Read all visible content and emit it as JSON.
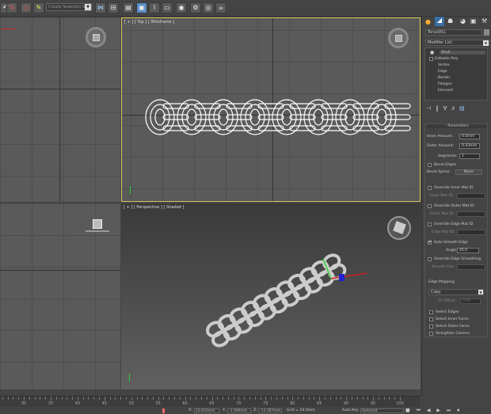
{
  "toolbar": {
    "selection_set": "Create Selection S",
    "icons": [
      "undo-icon",
      "percent-snap-icon",
      "spinner-snap-icon",
      "edit-named-selection-icon",
      "mirror-icon",
      "align-icon",
      "layer-manager-icon",
      "graphite-ribbon-icon",
      "curve-editor-icon",
      "schematic-view-icon",
      "material-editor-icon",
      "render-setup-icon",
      "render-frame-icon",
      "render-icon"
    ]
  },
  "viewports": {
    "top": {
      "label": "[ + ] [ Top ] [ Wireframe ]"
    },
    "perspective": {
      "label": "[ + ] [ Perspective ] [ Shaded ]"
    }
  },
  "command_panel": {
    "tabs": [
      "create-icon",
      "modify-icon",
      "hierarchy-icon",
      "motion-icon",
      "display-icon",
      "utilities-icon"
    ],
    "object_name": "Torus001",
    "modifier_list": "Modifier List",
    "stack": [
      {
        "label": "Shell",
        "level": 0
      },
      {
        "label": "Editable Poly",
        "level": 0
      },
      {
        "label": "Vertex",
        "level": 1
      },
      {
        "label": "Edge",
        "level": 1
      },
      {
        "label": "Border",
        "level": 1
      },
      {
        "label": "Polygon",
        "level": 1
      },
      {
        "label": "Element",
        "level": 1
      }
    ],
    "rollout_title": "Parameters",
    "inner_amount_label": "Inner Amount:",
    "inner_amount": "0.0mm",
    "outer_amount_label": "Outer Amount:",
    "outer_amount": "0.43mm",
    "segments_label": "Segments:",
    "segments": "1",
    "bevel_edges": "Bevel Edges",
    "bevel_spline_label": "Bevel Spline:",
    "bevel_spline": "None",
    "override_inner": "Override Inner Mat ID",
    "inner_mat_label": "Inner Mat ID:",
    "override_outer": "Override Outer Mat ID",
    "outer_mat_label": "Outer Mat ID:",
    "override_edge": "Override Edge Mat ID",
    "edge_mat_label": "Edge Mat ID:",
    "auto_smooth": "Auto Smooth Edge",
    "auto_smooth_checked": true,
    "angle_label": "Angle:",
    "angle": "45.0",
    "override_smooth": "Override Edge Smoothing",
    "smooth_grp_label": "Smooth Grp:",
    "edge_mapping_label": "Edge Mapping",
    "edge_mapping": "Copy",
    "tv_offset_label": "TV Offset:",
    "tv_offset": "0.05",
    "select_edges": "Select Edges",
    "select_inner": "Select Inner Faces",
    "select_outer": "Select Outer Faces",
    "straighten": "Straighten Corners"
  },
  "timeline": {
    "ticks": [
      30,
      35,
      40,
      45,
      50,
      55,
      60,
      65,
      70,
      75,
      80,
      85,
      90,
      95,
      100
    ]
  },
  "status": {
    "x": "23.816mm",
    "y": "-1.096mm",
    "z": "-13.187mm",
    "grid": "Grid = 10.0mm",
    "auto_key": "Auto Key",
    "selected": "Selected"
  },
  "colors": {
    "active_viewport": "#d8c25a",
    "active_button": "#5b8fc7",
    "x_axis": "#cc2222"
  }
}
